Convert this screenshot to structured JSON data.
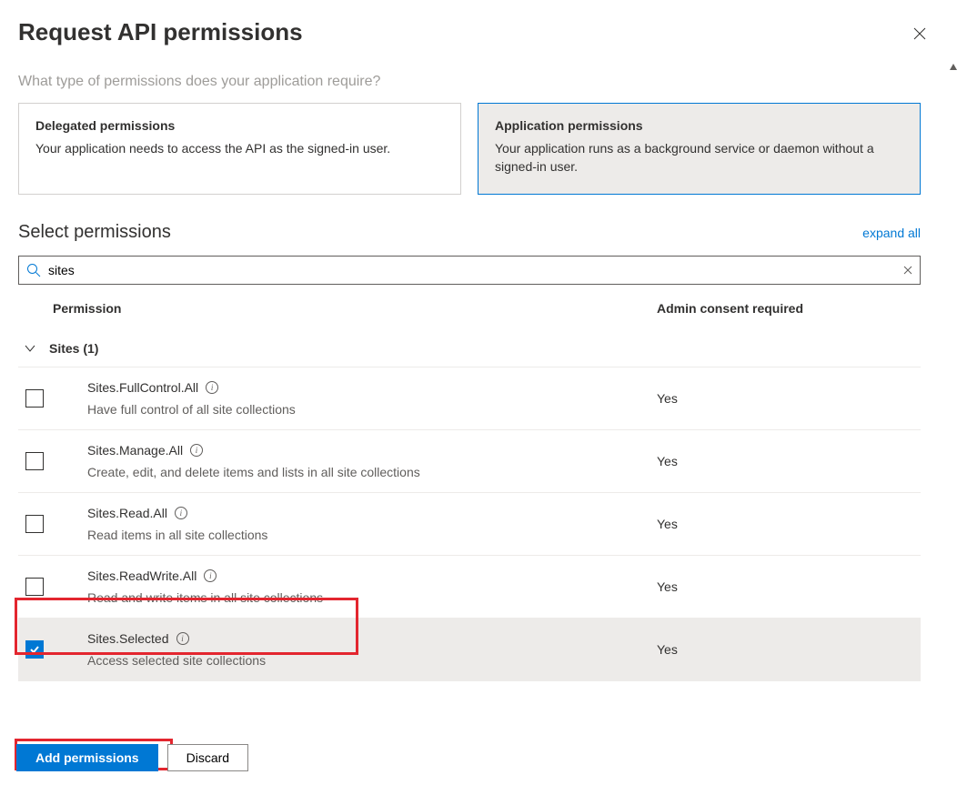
{
  "header": {
    "title": "Request API permissions"
  },
  "subheading": "What type of permissions does your application require?",
  "cards": {
    "delegated": {
      "title": "Delegated permissions",
      "desc": "Your application needs to access the API as the signed-in user."
    },
    "application": {
      "title": "Application permissions",
      "desc": "Your application runs as a background service or daemon without a signed-in user."
    }
  },
  "select": {
    "label": "Select permissions",
    "expand": "expand all"
  },
  "search": {
    "value": "sites"
  },
  "table": {
    "col_permission": "Permission",
    "col_consent": "Admin consent required"
  },
  "group": {
    "label": "Sites (1)"
  },
  "permissions": [
    {
      "name": "Sites.FullControl.All",
      "desc": "Have full control of all site collections",
      "consent": "Yes",
      "checked": false
    },
    {
      "name": "Sites.Manage.All",
      "desc": "Create, edit, and delete items and lists in all site collections",
      "consent": "Yes",
      "checked": false
    },
    {
      "name": "Sites.Read.All",
      "desc": "Read items in all site collections",
      "consent": "Yes",
      "checked": false
    },
    {
      "name": "Sites.ReadWrite.All",
      "desc": "Read and write items in all site collections",
      "consent": "Yes",
      "checked": false
    },
    {
      "name": "Sites.Selected",
      "desc": "Access selected site collections",
      "consent": "Yes",
      "checked": true
    }
  ],
  "footer": {
    "add": "Add permissions",
    "discard": "Discard"
  }
}
